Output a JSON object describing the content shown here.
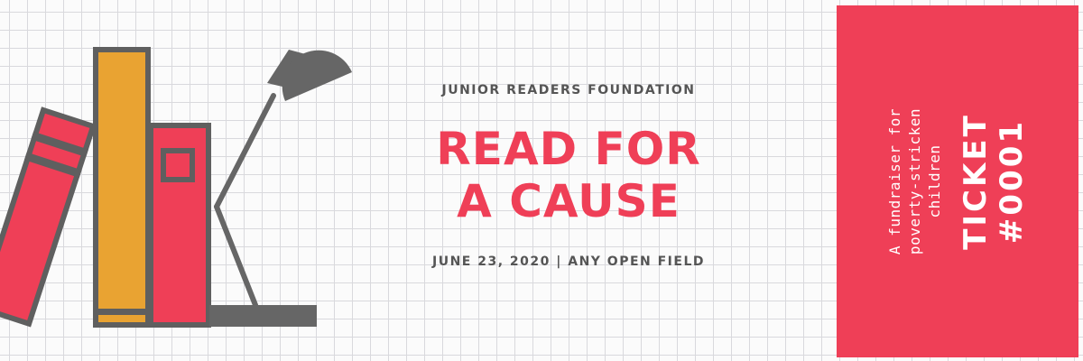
{
  "event": {
    "organizer": "JUNIOR READERS FOUNDATION",
    "title_line1": "READ FOR",
    "title_line2": "A CAUSE",
    "details": "JUNE 23, 2020 | ANY OPEN FIELD"
  },
  "stub": {
    "description_line1": "A fundraiser for",
    "description_line2": "poverty-stricken",
    "description_line3": "children",
    "ticket_line1": "TICKET",
    "ticket_line2": "#0001"
  },
  "colors": {
    "accent_red": "#ef3f57",
    "book_orange": "#e9a332",
    "lamp_gray": "#666666",
    "outline_gray": "#5f5f5f",
    "text_gray": "#555555",
    "grid": "#d9d9dd"
  },
  "icons": [
    "books-icon",
    "desk-lamp-icon"
  ]
}
